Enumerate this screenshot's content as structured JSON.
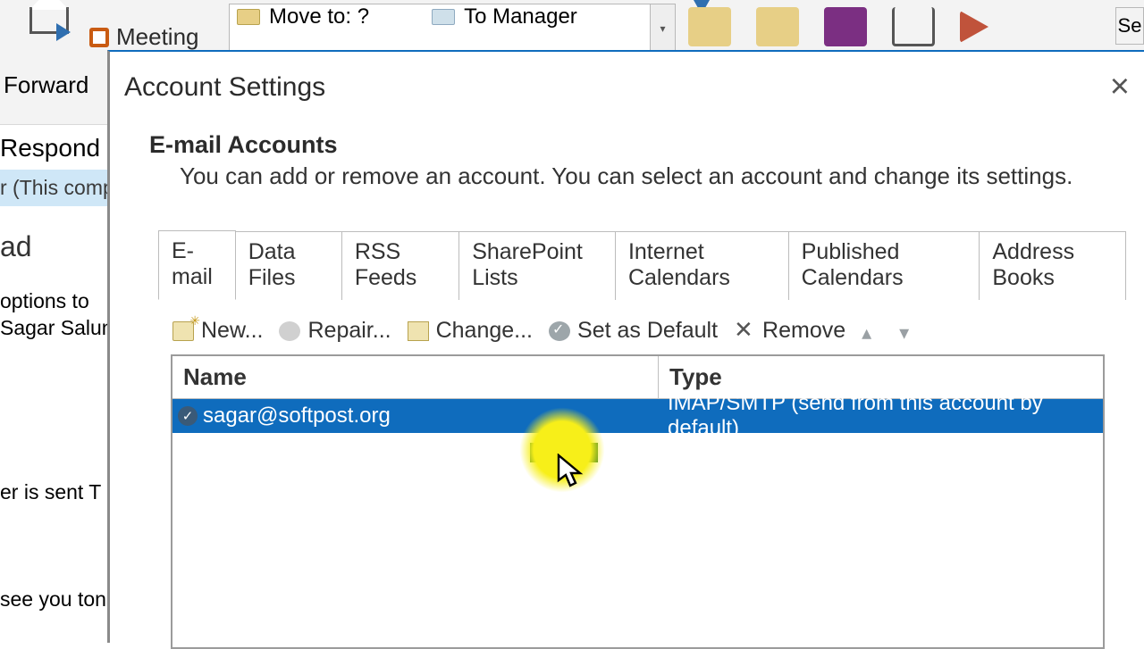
{
  "ribbon": {
    "forward": "Forward",
    "meeting": "Meeting",
    "move_to": "Move to: ?",
    "to_manager": "To Manager",
    "search_prefix": "Se",
    "respond_group": "Respond"
  },
  "left_pane": {
    "this_comp": "r (This comp",
    "ad": "ad",
    "options": " options to",
    "sagar": "Sagar Salunl",
    "sent": "er is sent   T",
    "see_you": " see you ton"
  },
  "dialog": {
    "title": "Account Settings",
    "section_title": "E-mail Accounts",
    "section_desc": "You can add or remove an account. You can select an account and change its settings.",
    "tabs": {
      "email": "E-mail",
      "data_files": "Data Files",
      "rss": "RSS Feeds",
      "sp": "SharePoint Lists",
      "ical": "Internet Calendars",
      "pub": "Published Calendars",
      "ab": "Address Books"
    },
    "toolbar": {
      "new": "New...",
      "repair": "Repair...",
      "change": "Change...",
      "default": "Set as Default",
      "remove": "Remove"
    },
    "table": {
      "col_name": "Name",
      "col_type": "Type",
      "row_name": "sagar@softpost.org",
      "row_type": "IMAP/SMTP (send from this account by default)"
    }
  }
}
